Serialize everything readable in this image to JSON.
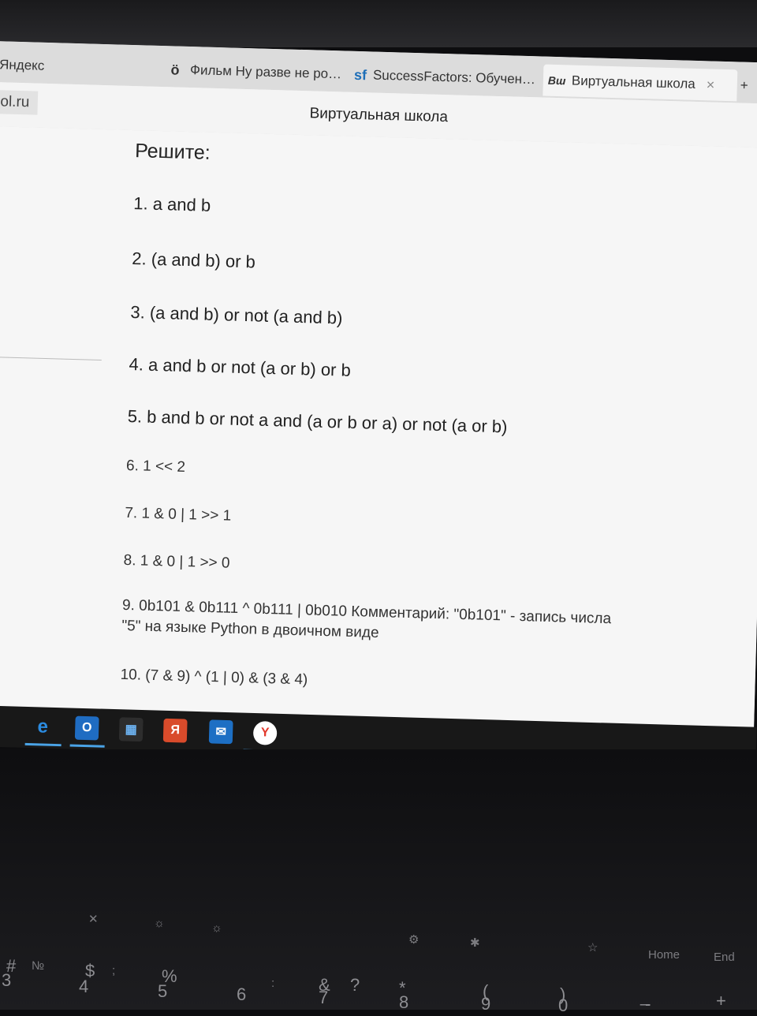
{
  "browser": {
    "tabs": [
      {
        "label": "Яндекс",
        "icon": "yandex-icon"
      },
      {
        "label": "Фильм Ну разве не ро…",
        "icon": "kinopoisk-icon"
      },
      {
        "label": "SuccessFactors: Обучен…",
        "icon": "sf-icon"
      },
      {
        "label": "Виртуальная школа",
        "icon": "vsh-icon",
        "active": true
      }
    ],
    "address": "ool.ru",
    "page_title": "Виртуальная школа",
    "close_glyph": "×",
    "new_tab_glyph": "+"
  },
  "page": {
    "heading": "Решите:",
    "tasks": [
      "1. a and b",
      "2. (a and b) or b",
      "3. (a and b) or not (a and b)",
      "4. a and b or not (a or b) or b",
      "5. b and b or not a and (a or b or a) or not (a or b)",
      "6. 1 << 2",
      "7. 1 & 0 | 1 >> 1",
      "8. 1 & 0 | 1 >> 0",
      "9. 0b101 & 0b111 ^ 0b111 | 0b010  Комментарий: \"0b101\" - запись числа",
      "\"5\" на языке Python в двоичном виде",
      "10. (7 & 9) ^ (1 | 0) & (3 & 4)"
    ]
  },
  "taskbar": {
    "icons": [
      "edge-icon",
      "outlook-icon",
      "store-icon",
      "yandex-browser-icon",
      "mail-icon",
      "yandex-y-icon"
    ]
  },
  "keyboard": {
    "fn_row": [
      "Home",
      "End"
    ],
    "number_row": [
      "#",
      "№",
      "3",
      "$",
      ";",
      "4",
      "%",
      "5",
      "6",
      ":",
      "&",
      "?",
      "7",
      "*",
      "8",
      "(",
      "9",
      ")",
      "0",
      "_",
      "-",
      "+"
    ]
  }
}
